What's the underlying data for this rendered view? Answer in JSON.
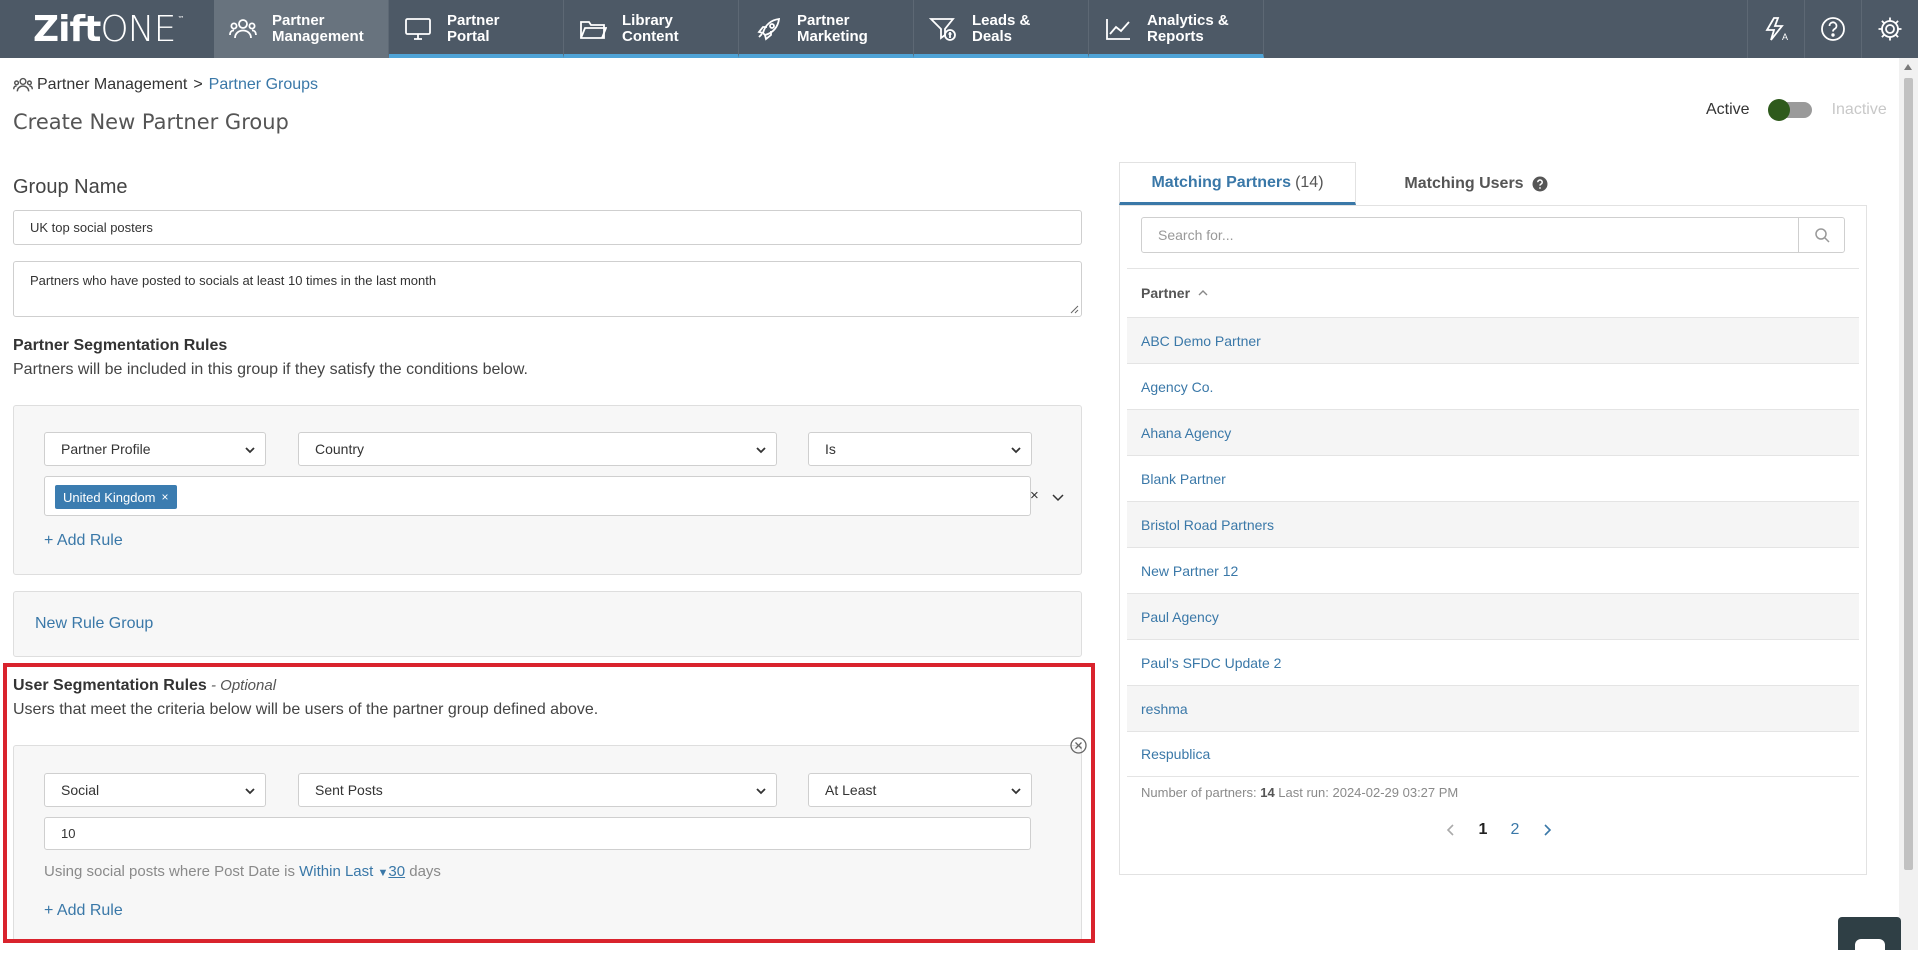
{
  "app": {
    "logo_text_bold": "Zift",
    "logo_text_light": "ONE",
    "logo_tm": "™",
    "brand_accent": "#4fa3d6",
    "nav_bg": "#4d5966"
  },
  "nav": {
    "tabs": [
      {
        "label": "Partner\nManagement",
        "icon": "users-icon"
      },
      {
        "label": "Partner\nPortal",
        "icon": "monitor-icon"
      },
      {
        "label": "Library\nContent",
        "icon": "folder-icon"
      },
      {
        "label": "Partner\nMarketing",
        "icon": "rocket-icon"
      },
      {
        "label": "Leads &\nDeals",
        "icon": "funnel-dollar-icon"
      },
      {
        "label": "Analytics &\nReports",
        "icon": "line-chart-icon"
      }
    ],
    "right_icons": [
      "translate-icon",
      "help-icon",
      "gear-icon"
    ]
  },
  "breadcrumb": {
    "root": "Partner Management",
    "separator": ">",
    "current": "Partner Groups"
  },
  "page": {
    "title": "Create New Partner Group",
    "status_active": "Active",
    "status_inactive": "Inactive"
  },
  "group": {
    "heading": "Group Name",
    "name_value": "UK top social posters",
    "description_value": "Partners who have posted to socials at least 10 times in the last month"
  },
  "partner_rules": {
    "title": "Partner Segmentation Rules",
    "description": "Partners will be included in this group if they satisfy the conditions below.",
    "select_category": "Partner Profile",
    "select_field": "Country",
    "select_operator": "Is",
    "tag_value": "United Kingdom",
    "tag_remove": "×",
    "clear": "×",
    "add_rule": "+ Add Rule",
    "new_rule_group": "New Rule Group"
  },
  "user_rules": {
    "title": "User Segmentation Rules",
    "optional": " - Optional",
    "description": "Users that meet the criteria below will be users of the partner group defined above.",
    "select_category": "Social",
    "select_field": "Sent Posts",
    "select_operator": "At Least",
    "value": "10",
    "hint_prefix": "Using social posts where Post Date is ",
    "hint_link": "Within Last",
    "hint_number": "30",
    "hint_suffix": " days",
    "add_rule": "+ Add Rule"
  },
  "matching": {
    "tab_partners": "Matching Partners",
    "tab_partners_count": "(14)",
    "tab_users": "Matching Users",
    "search_placeholder": "Search for...",
    "column_partner": "Partner",
    "partners": [
      "ABC Demo Partner",
      "Agency Co.",
      "Ahana Agency",
      "Blank Partner",
      "Bristol Road Partners",
      "New Partner 12",
      "Paul Agency",
      "Paul's SFDC Update 2",
      "reshma",
      "Respublica"
    ],
    "footer_label": "Number of partners: ",
    "footer_count": "14",
    "footer_last_run": " Last run: 2024-02-29 03:27 PM",
    "pages": [
      "1",
      "2"
    ]
  }
}
